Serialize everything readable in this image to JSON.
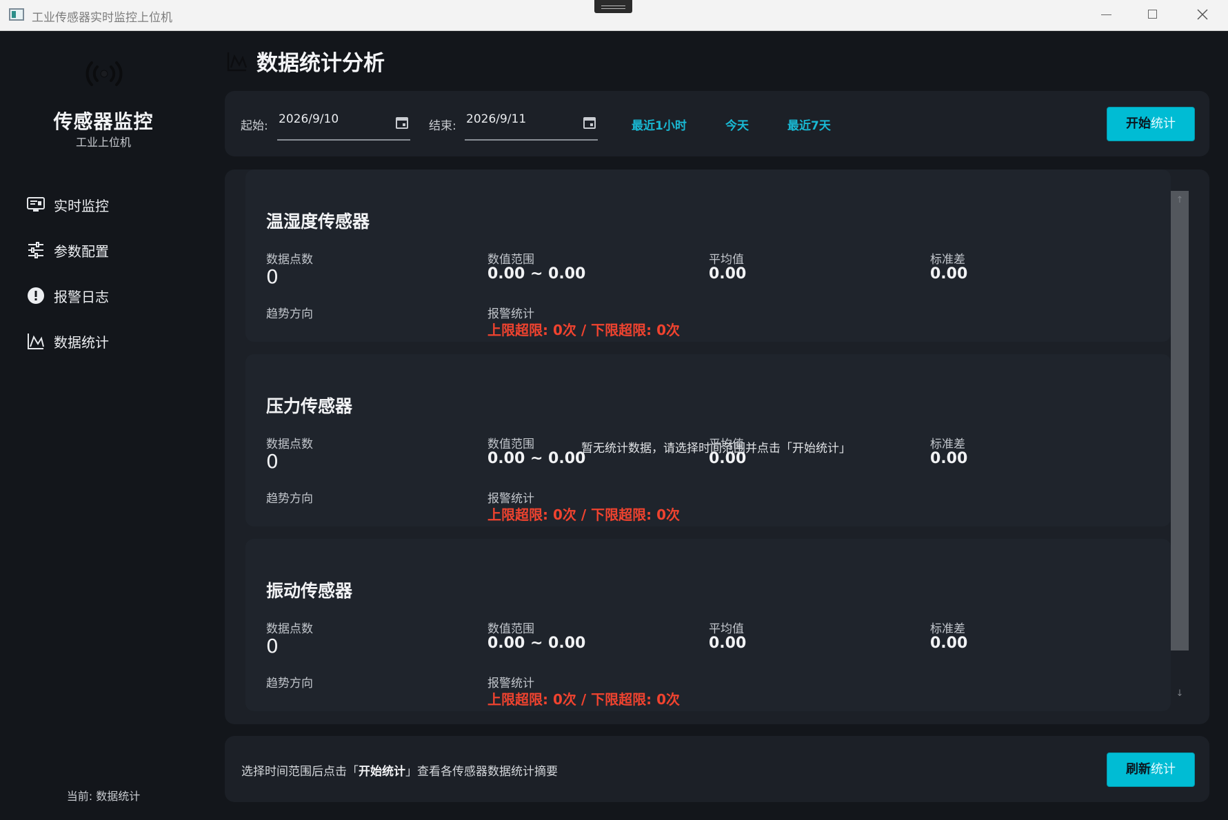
{
  "window": {
    "title": "工业传感器实时监控上位机"
  },
  "sidebar": {
    "brand_title": "传感器监控",
    "brand_subtitle": "工业上位机",
    "items": [
      {
        "label": "实时监控",
        "icon": "monitor-icon"
      },
      {
        "label": "参数配置",
        "icon": "sliders-icon"
      },
      {
        "label": "报警日志",
        "icon": "alert-icon"
      },
      {
        "label": "数据统计",
        "icon": "chart-icon"
      }
    ],
    "status": "当前: 数据统计"
  },
  "page": {
    "title": "数据统计分析"
  },
  "filter": {
    "start_label": "起始:",
    "start_value": "2026/9/10",
    "end_label": "结束:",
    "end_value": "2026/9/11",
    "quick_ranges": [
      "最近1小时",
      "今天",
      "最近7天"
    ],
    "start_button": {
      "bold": "开始",
      "light": "统计"
    }
  },
  "labels": {
    "count": "数据点数",
    "range": "数值范围",
    "avg": "平均值",
    "std": "标准差",
    "trend": "趋势方向",
    "alarm": "报警统计"
  },
  "sensors": [
    {
      "name": "温湿度传感器",
      "count": "0",
      "range": "0.00 ~ 0.00",
      "avg": "0.00",
      "std": "0.00",
      "alarm": "上限超限: 0次 / 下限超限: 0次"
    },
    {
      "name": "压力传感器",
      "count": "0",
      "range": "0.00 ~ 0.00",
      "avg": "0.00",
      "std": "0.00",
      "alarm": "上限超限: 0次 / 下限超限: 0次"
    },
    {
      "name": "振动传感器",
      "count": "0",
      "range": "0.00 ~ 0.00",
      "avg": "0.00",
      "std": "0.00",
      "alarm": "上限超限: 0次 / 下限超限: 0次"
    }
  ],
  "empty_message": "暂无统计数据，请选择时间范围并点击「开始统计」",
  "bottom": {
    "hint_prefix": "选择时间范围后点击「",
    "hint_bold": "开始统计",
    "hint_suffix": "」查看各传感器数据统计摘要",
    "refresh_button": {
      "bold": "刷新",
      "light": "统计"
    }
  },
  "colors": {
    "accent": "#00bcd4",
    "alarm": "#f0432f",
    "background": "#13161b",
    "panel": "#1c2027"
  }
}
